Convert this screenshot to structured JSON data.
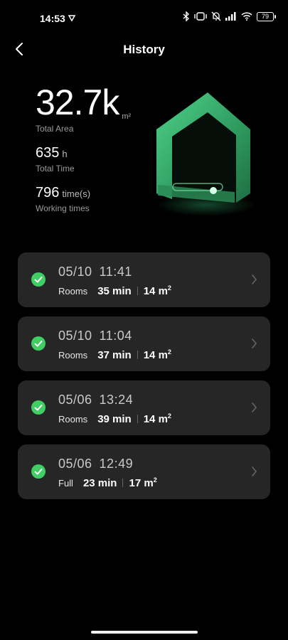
{
  "status_bar": {
    "time": "14:53",
    "battery": "79"
  },
  "header": {
    "title": "History"
  },
  "summary": {
    "total_area": {
      "value": "32.7k",
      "unit": "m²",
      "label": "Total Area"
    },
    "total_time": {
      "value": "635",
      "unit": "h",
      "label": "Total Time"
    },
    "working_times": {
      "value": "796",
      "unit": "time(s)",
      "label": "Working times"
    }
  },
  "records": [
    {
      "date": "05/10",
      "time": "11:41",
      "mode": "Rooms",
      "duration": "35 min",
      "area": "14 m",
      "area_sup": "2"
    },
    {
      "date": "05/10",
      "time": "11:04",
      "mode": "Rooms",
      "duration": "37 min",
      "area": "14 m",
      "area_sup": "2"
    },
    {
      "date": "05/06",
      "time": "13:24",
      "mode": "Rooms",
      "duration": "39 min",
      "area": "14 m",
      "area_sup": "2"
    },
    {
      "date": "05/06",
      "time": "12:49",
      "mode": "Full",
      "duration": "23 min",
      "area": "17 m",
      "area_sup": "2"
    }
  ],
  "colors": {
    "background": "#000000",
    "card": "#262626",
    "success": "#3fcf62",
    "accent_green": "#2e9a5e"
  }
}
